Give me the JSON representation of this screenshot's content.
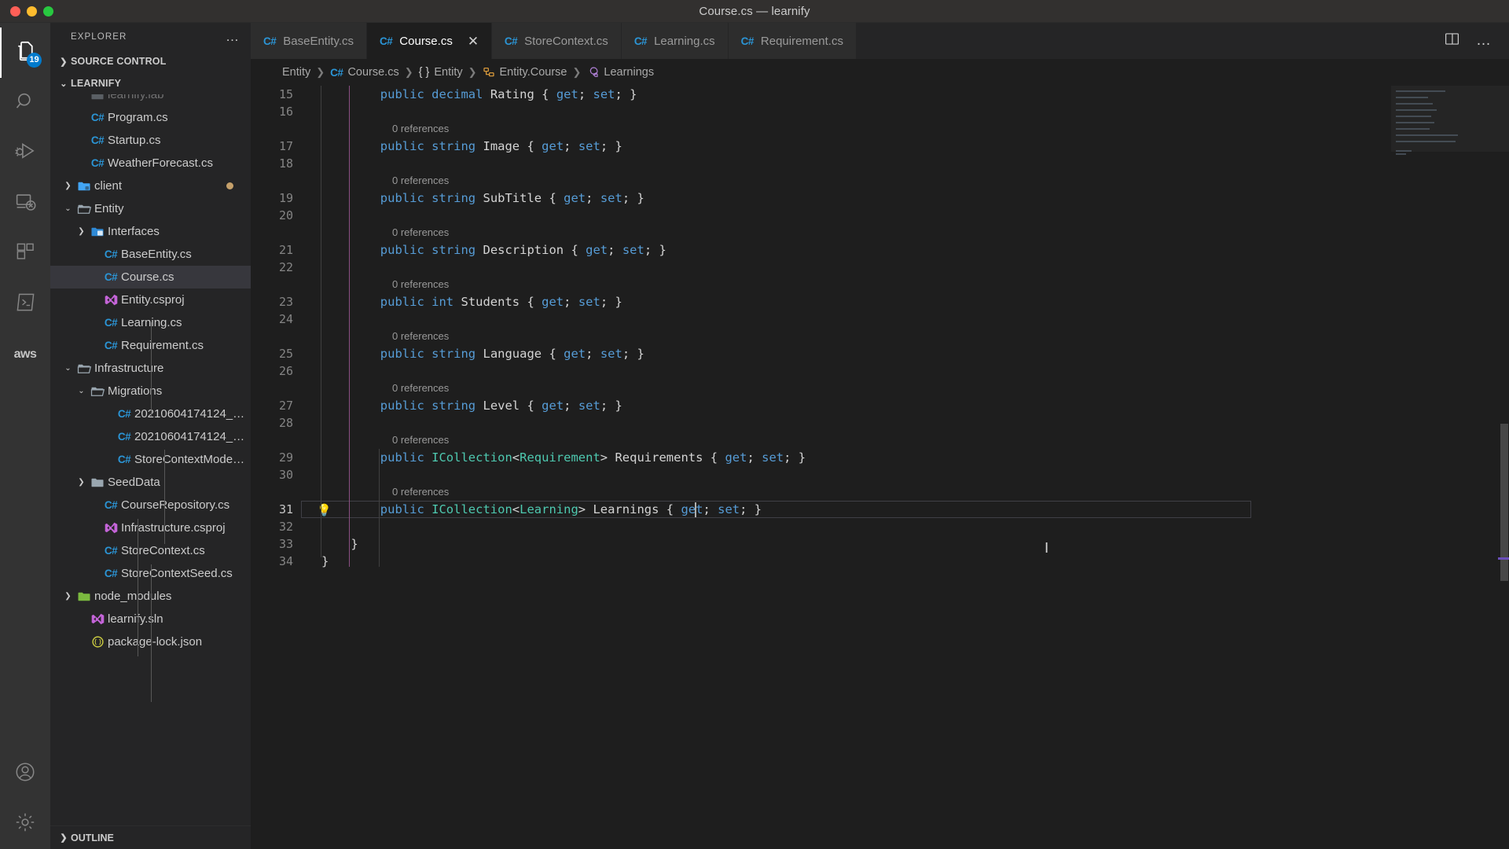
{
  "window": {
    "title": "Course.cs — learnify",
    "traffic_lights": [
      "close",
      "minimize",
      "maximize"
    ]
  },
  "activity_bar": {
    "items": [
      {
        "name": "explorer",
        "icon": "files-icon",
        "badge": "19",
        "active": true
      },
      {
        "name": "search",
        "icon": "search-icon",
        "badge": "",
        "active": false
      },
      {
        "name": "run-and-debug",
        "icon": "debug-icon",
        "badge": "",
        "active": false
      },
      {
        "name": "remote-explorer",
        "icon": "remote-icon",
        "badge": "",
        "active": false
      },
      {
        "name": "extensions",
        "icon": "extensions-icon",
        "badge": "",
        "active": false
      },
      {
        "name": "terminal",
        "icon": "terminal-icon",
        "badge": "",
        "active": false
      },
      {
        "name": "aws-toolkit",
        "icon": "aws-icon",
        "badge": "",
        "active": false
      }
    ],
    "bottom_items": [
      {
        "name": "accounts",
        "icon": "account-icon"
      },
      {
        "name": "settings",
        "icon": "gear-icon"
      }
    ]
  },
  "sidebar": {
    "header_title": "EXPLORER",
    "header_more": "…",
    "sections": [
      {
        "label": "SOURCE CONTROL",
        "expanded": false
      },
      {
        "label": "LEARNIFY",
        "expanded": true
      }
    ],
    "bottom_section": {
      "label": "OUTLINE",
      "expanded": false
    },
    "tree": [
      {
        "label": "learnify.lab",
        "icon": "folder-icon",
        "indent": 2,
        "type": "file",
        "clipped": true
      },
      {
        "label": "Program.cs",
        "icon": "csharp-icon",
        "indent": 2,
        "type": "file"
      },
      {
        "label": "Startup.cs",
        "icon": "csharp-icon",
        "indent": 2,
        "type": "file"
      },
      {
        "label": "WeatherForecast.cs",
        "icon": "csharp-icon",
        "indent": 2,
        "type": "file"
      },
      {
        "label": "client",
        "icon": "folder-client-icon",
        "indent": 1,
        "type": "folder",
        "expanded": false,
        "dirty": true
      },
      {
        "label": "Entity",
        "icon": "folder-open-icon",
        "indent": 1,
        "type": "folder",
        "expanded": true
      },
      {
        "label": "Interfaces",
        "icon": "folder-interface-icon",
        "indent": 2,
        "type": "folder",
        "expanded": false
      },
      {
        "label": "BaseEntity.cs",
        "icon": "csharp-icon",
        "indent": 3,
        "type": "file"
      },
      {
        "label": "Course.cs",
        "icon": "csharp-icon",
        "indent": 3,
        "type": "file",
        "selected": true
      },
      {
        "label": "Entity.csproj",
        "icon": "vs-icon",
        "indent": 3,
        "type": "file"
      },
      {
        "label": "Learning.cs",
        "icon": "csharp-icon",
        "indent": 3,
        "type": "file"
      },
      {
        "label": "Requirement.cs",
        "icon": "csharp-icon",
        "indent": 3,
        "type": "file"
      },
      {
        "label": "Infrastructure",
        "icon": "folder-open-icon",
        "indent": 1,
        "type": "folder",
        "expanded": true
      },
      {
        "label": "Migrations",
        "icon": "folder-open-icon",
        "indent": 2,
        "type": "folder",
        "expanded": true
      },
      {
        "label": "20210604174124_…",
        "icon": "csharp-icon",
        "indent": 4,
        "type": "file"
      },
      {
        "label": "20210604174124_…",
        "icon": "csharp-icon",
        "indent": 4,
        "type": "file"
      },
      {
        "label": "StoreContextMode…",
        "icon": "csharp-icon",
        "indent": 4,
        "type": "file"
      },
      {
        "label": "SeedData",
        "icon": "folder-icon",
        "indent": 2,
        "type": "folder",
        "expanded": false
      },
      {
        "label": "CourseRepository.cs",
        "icon": "csharp-icon",
        "indent": 3,
        "type": "file"
      },
      {
        "label": "Infrastructure.csproj",
        "icon": "vs-icon",
        "indent": 3,
        "type": "file"
      },
      {
        "label": "StoreContext.cs",
        "icon": "csharp-icon",
        "indent": 3,
        "type": "file"
      },
      {
        "label": "StoreContextSeed.cs",
        "icon": "csharp-icon",
        "indent": 3,
        "type": "file"
      },
      {
        "label": "node_modules",
        "icon": "folder-node-icon",
        "indent": 1,
        "type": "folder",
        "expanded": false
      },
      {
        "label": "learnify.sln",
        "icon": "vs-icon",
        "indent": 2,
        "type": "file"
      },
      {
        "label": "package-lock.json",
        "icon": "json-icon",
        "indent": 2,
        "type": "file"
      }
    ]
  },
  "tabs": [
    {
      "label": "BaseEntity.cs",
      "icon": "csharp-icon",
      "active": false,
      "closable": false
    },
    {
      "label": "Course.cs",
      "icon": "csharp-icon",
      "active": true,
      "closable": true,
      "close_glyph": "✕"
    },
    {
      "label": "StoreContext.cs",
      "icon": "csharp-icon",
      "active": false,
      "closable": false
    },
    {
      "label": "Learning.cs",
      "icon": "csharp-icon",
      "active": false,
      "closable": false
    },
    {
      "label": "Requirement.cs",
      "icon": "csharp-icon",
      "active": false,
      "closable": false
    }
  ],
  "editor_actions": [
    {
      "name": "split-editor",
      "icon": "split-editor-icon"
    },
    {
      "name": "more-actions",
      "icon": "ellipsis-icon",
      "glyph": "…"
    }
  ],
  "breadcrumbs": [
    {
      "label": "Entity",
      "icon": ""
    },
    {
      "label": "Course.cs",
      "icon": "csharp-icon"
    },
    {
      "label": "Entity",
      "icon": "namespace-icon"
    },
    {
      "label": "Entity.Course",
      "icon": "class-icon"
    },
    {
      "label": "Learnings",
      "icon": "property-icon"
    }
  ],
  "breadcrumb_separator": "❯",
  "code": {
    "reference_label": "0 references",
    "lines": [
      {
        "num": "15",
        "tokens": [
          {
            "t": "public",
            "c": "k"
          },
          {
            "t": " ",
            "c": "pn"
          },
          {
            "t": "decimal",
            "c": "k"
          },
          {
            "t": " ",
            "c": "pn"
          },
          {
            "t": "Rating",
            "c": "id"
          },
          {
            "t": " { ",
            "c": "pn"
          },
          {
            "t": "get",
            "c": "ac"
          },
          {
            "t": "; ",
            "c": "pn"
          },
          {
            "t": "set",
            "c": "ac"
          },
          {
            "t": "; }",
            "c": "pn"
          }
        ],
        "lens": false
      },
      {
        "num": "16",
        "tokens": [],
        "lens": false
      },
      {
        "num": "17",
        "tokens": [
          {
            "t": "public",
            "c": "k"
          },
          {
            "t": " ",
            "c": "pn"
          },
          {
            "t": "string",
            "c": "k"
          },
          {
            "t": " ",
            "c": "pn"
          },
          {
            "t": "Image",
            "c": "id"
          },
          {
            "t": " { ",
            "c": "pn"
          },
          {
            "t": "get",
            "c": "ac"
          },
          {
            "t": "; ",
            "c": "pn"
          },
          {
            "t": "set",
            "c": "ac"
          },
          {
            "t": "; }",
            "c": "pn"
          }
        ],
        "lens": true
      },
      {
        "num": "18",
        "tokens": [],
        "lens": false
      },
      {
        "num": "19",
        "tokens": [
          {
            "t": "public",
            "c": "k"
          },
          {
            "t": " ",
            "c": "pn"
          },
          {
            "t": "string",
            "c": "k"
          },
          {
            "t": " ",
            "c": "pn"
          },
          {
            "t": "SubTitle",
            "c": "id"
          },
          {
            "t": " { ",
            "c": "pn"
          },
          {
            "t": "get",
            "c": "ac"
          },
          {
            "t": "; ",
            "c": "pn"
          },
          {
            "t": "set",
            "c": "ac"
          },
          {
            "t": "; }",
            "c": "pn"
          }
        ],
        "lens": true
      },
      {
        "num": "20",
        "tokens": [],
        "lens": false
      },
      {
        "num": "21",
        "tokens": [
          {
            "t": "public",
            "c": "k"
          },
          {
            "t": " ",
            "c": "pn"
          },
          {
            "t": "string",
            "c": "k"
          },
          {
            "t": " ",
            "c": "pn"
          },
          {
            "t": "Description",
            "c": "id"
          },
          {
            "t": " { ",
            "c": "pn"
          },
          {
            "t": "get",
            "c": "ac"
          },
          {
            "t": "; ",
            "c": "pn"
          },
          {
            "t": "set",
            "c": "ac"
          },
          {
            "t": "; }",
            "c": "pn"
          }
        ],
        "lens": true
      },
      {
        "num": "22",
        "tokens": [],
        "lens": false
      },
      {
        "num": "23",
        "tokens": [
          {
            "t": "public",
            "c": "k"
          },
          {
            "t": " ",
            "c": "pn"
          },
          {
            "t": "int",
            "c": "k"
          },
          {
            "t": " ",
            "c": "pn"
          },
          {
            "t": "Students",
            "c": "id"
          },
          {
            "t": " { ",
            "c": "pn"
          },
          {
            "t": "get",
            "c": "ac"
          },
          {
            "t": "; ",
            "c": "pn"
          },
          {
            "t": "set",
            "c": "ac"
          },
          {
            "t": "; }",
            "c": "pn"
          }
        ],
        "lens": true
      },
      {
        "num": "24",
        "tokens": [],
        "lens": false
      },
      {
        "num": "25",
        "tokens": [
          {
            "t": "public",
            "c": "k"
          },
          {
            "t": " ",
            "c": "pn"
          },
          {
            "t": "string",
            "c": "k"
          },
          {
            "t": " ",
            "c": "pn"
          },
          {
            "t": "Language",
            "c": "id"
          },
          {
            "t": " { ",
            "c": "pn"
          },
          {
            "t": "get",
            "c": "ac"
          },
          {
            "t": "; ",
            "c": "pn"
          },
          {
            "t": "set",
            "c": "ac"
          },
          {
            "t": "; }",
            "c": "pn"
          }
        ],
        "lens": true
      },
      {
        "num": "26",
        "tokens": [],
        "lens": false
      },
      {
        "num": "27",
        "tokens": [
          {
            "t": "public",
            "c": "k"
          },
          {
            "t": " ",
            "c": "pn"
          },
          {
            "t": "string",
            "c": "k"
          },
          {
            "t": " ",
            "c": "pn"
          },
          {
            "t": "Level",
            "c": "id"
          },
          {
            "t": " { ",
            "c": "pn"
          },
          {
            "t": "get",
            "c": "ac"
          },
          {
            "t": "; ",
            "c": "pn"
          },
          {
            "t": "set",
            "c": "ac"
          },
          {
            "t": "; }",
            "c": "pn"
          }
        ],
        "lens": true
      },
      {
        "num": "28",
        "tokens": [],
        "lens": false
      },
      {
        "num": "29",
        "tokens": [
          {
            "t": "public",
            "c": "k"
          },
          {
            "t": " ",
            "c": "pn"
          },
          {
            "t": "ICollection",
            "c": "ty"
          },
          {
            "t": "<",
            "c": "pn"
          },
          {
            "t": "Requirement",
            "c": "gen"
          },
          {
            "t": "> ",
            "c": "pn"
          },
          {
            "t": "Requirements",
            "c": "id"
          },
          {
            "t": " { ",
            "c": "pn"
          },
          {
            "t": "get",
            "c": "ac"
          },
          {
            "t": "; ",
            "c": "pn"
          },
          {
            "t": "set",
            "c": "ac"
          },
          {
            "t": "; }",
            "c": "pn"
          }
        ],
        "lens": true
      },
      {
        "num": "30",
        "tokens": [],
        "lens": false
      },
      {
        "num": "31",
        "tokens": [
          {
            "t": "public",
            "c": "k"
          },
          {
            "t": " ",
            "c": "pn"
          },
          {
            "t": "ICollection",
            "c": "ty"
          },
          {
            "t": "<",
            "c": "pn"
          },
          {
            "t": "Learning",
            "c": "gen"
          },
          {
            "t": "> ",
            "c": "pn"
          },
          {
            "t": "Learnings",
            "c": "id"
          },
          {
            "t": " { ",
            "c": "pn"
          },
          {
            "t": "get",
            "c": "ac"
          },
          {
            "t": "; ",
            "c": "pn"
          },
          {
            "t": "set",
            "c": "ac"
          },
          {
            "t": "; }",
            "c": "pn"
          }
        ],
        "lens": true,
        "current": true,
        "bulb": "💡"
      },
      {
        "num": "32",
        "tokens": [],
        "lens": false
      },
      {
        "num": "33",
        "tokens": [
          {
            "t": "}",
            "c": "pn"
          }
        ],
        "lens": false,
        "closing": true
      },
      {
        "num": "34",
        "tokens": [
          {
            "t": "}",
            "c": "pn"
          }
        ],
        "lens": false,
        "closing_outer": true
      }
    ]
  },
  "colors": {
    "accent": "#007acc",
    "editor_bg": "#1e1e1e",
    "sidebar_bg": "#252526",
    "activitybar_bg": "#333333",
    "titlebar_bg": "#32302f",
    "keyword": "#569cd6",
    "type": "#4ec9b0",
    "identifier": "#d4d4d4",
    "csharp_icon": "#2b95d6",
    "vs_icon": "#c464d8",
    "lens_text": "#999999"
  }
}
